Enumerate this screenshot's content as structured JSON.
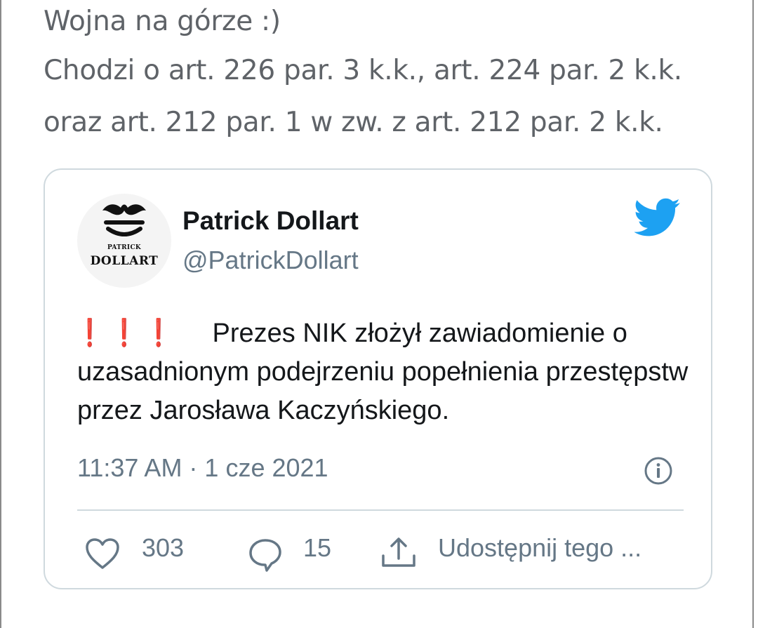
{
  "post": {
    "line1": "Wojna na górze :)",
    "line2": "Chodzi o art. 226 par. 3 k.k., art. 224 par. 2 k.k.",
    "line3": "oraz art. 212 par. 1 w zw. z art. 212 par. 2 k.k."
  },
  "tweet": {
    "avatar_logo": {
      "small": "PATRICK",
      "big": "DOLLART"
    },
    "author_name": "Patrick Dollart",
    "author_handle": "@PatrickDollart",
    "platform_icon": "twitter-bird-icon",
    "emphasis_marks": "❗❗❗",
    "text": "Prezes NIK złożył zawiadomienie o uzasadnionym podejrzeniu popełnienia przestępstw przez Jarosława Kaczyńskiego.",
    "timestamp": "11:37 AM · 1 cze 2021",
    "likes": "303",
    "replies": "15",
    "share_label": "Udostępnij tego ..."
  },
  "colors": {
    "post_text": "#5f6368",
    "tweet_text": "#14171a",
    "muted": "#657786",
    "twitter_blue": "#1da1f2",
    "card_border": "#cfd9de",
    "emphasis_red": "#c8102e"
  }
}
